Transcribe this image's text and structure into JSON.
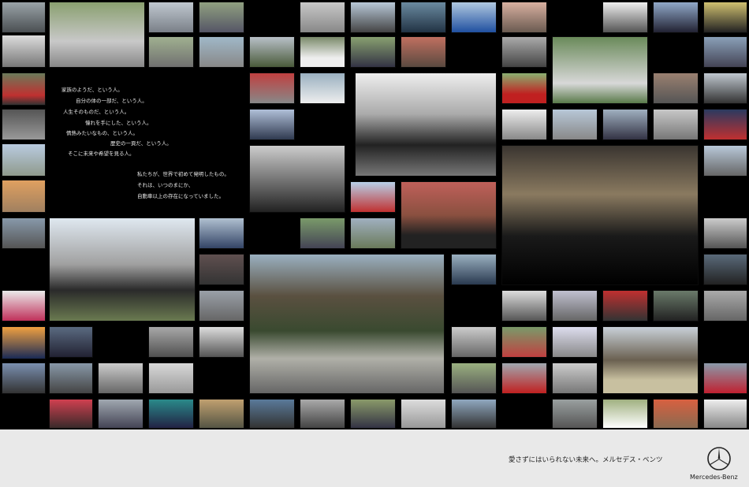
{
  "copy": {
    "lines": [
      "家族のようだ、という人。",
      "自分の体の一部だ、という人。",
      "人生そのものだ、という人。",
      "憧れを手にした、という人。",
      "情熱みたいなもの、という人。",
      "歴史の一頁だ、という人。",
      "そこに未来や希望を見る人。",
      "私たちが、世界で初めて発明したもの。",
      "それは、いつのまにか、",
      "自動車以上の存在になっていました。"
    ]
  },
  "footer": {
    "tagline": "愛さずにはいられない未来へ。メルセデス・ベンツ",
    "brand": "Mercedes-Benz"
  },
  "colors": {
    "background": "#000000",
    "footer_bg": "#e9e9e9",
    "text_light": "#e8e8e8",
    "text_dark": "#222222"
  }
}
